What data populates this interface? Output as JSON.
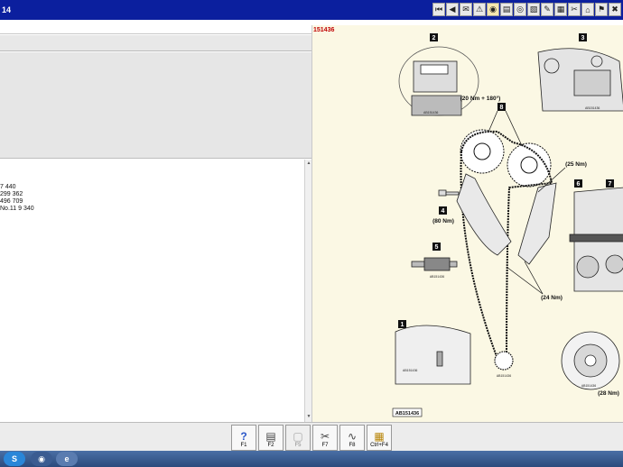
{
  "window": {
    "title": "14"
  },
  "toolbar": {
    "icons": [
      "first-page-icon",
      "back-icon",
      "mail-icon",
      "warning-icon",
      "camera-icon",
      "document-icon",
      "cd-icon",
      "print-icon",
      "bookmark-icon",
      "document-icon",
      "tools-icon",
      "home-icon",
      "flag-icon",
      "flag-icon"
    ],
    "glyphs": [
      "⏮",
      "◀",
      "✉",
      "⚠",
      "◉",
      "▤",
      "◎",
      "▧",
      "✎",
      "▦",
      "✂",
      "⌂",
      "⚑",
      "✖"
    ]
  },
  "left_panel": {
    "lines": [
      "7 440",
      "299 362",
      "496 709",
      "No.11 9 340"
    ]
  },
  "diagram": {
    "figure_id": "151436",
    "callouts": [
      "1",
      "2",
      "3",
      "4",
      "5",
      "6",
      "7",
      "8"
    ],
    "torques": {
      "t8": "(20 Nm + 180°)",
      "t25": "(25 Nm)",
      "t80": "(80 Nm)",
      "t24": "(24 Nm)",
      "t28": "(28 Nm)"
    },
    "ref_codes": {
      "r2": "AB151436",
      "r3": "AB151436",
      "r5": "AB151436",
      "r1": "AB151436",
      "r_center": "AB151436",
      "r_pulley": "AB151436"
    },
    "bottom_label": "AB151436"
  },
  "function_keys": [
    {
      "label": "F1",
      "icon": "?"
    },
    {
      "label": "F2",
      "icon": "▤"
    },
    {
      "label": "F5",
      "icon": "▢"
    },
    {
      "label": "F7",
      "icon": "✂"
    },
    {
      "label": "F8",
      "icon": "∿"
    },
    {
      "label": "Ctrl+F4",
      "icon": "▦"
    }
  ],
  "taskbar": {
    "apps": [
      "skype-icon",
      "diagnostic-app-icon",
      "explorer-icon"
    ]
  }
}
